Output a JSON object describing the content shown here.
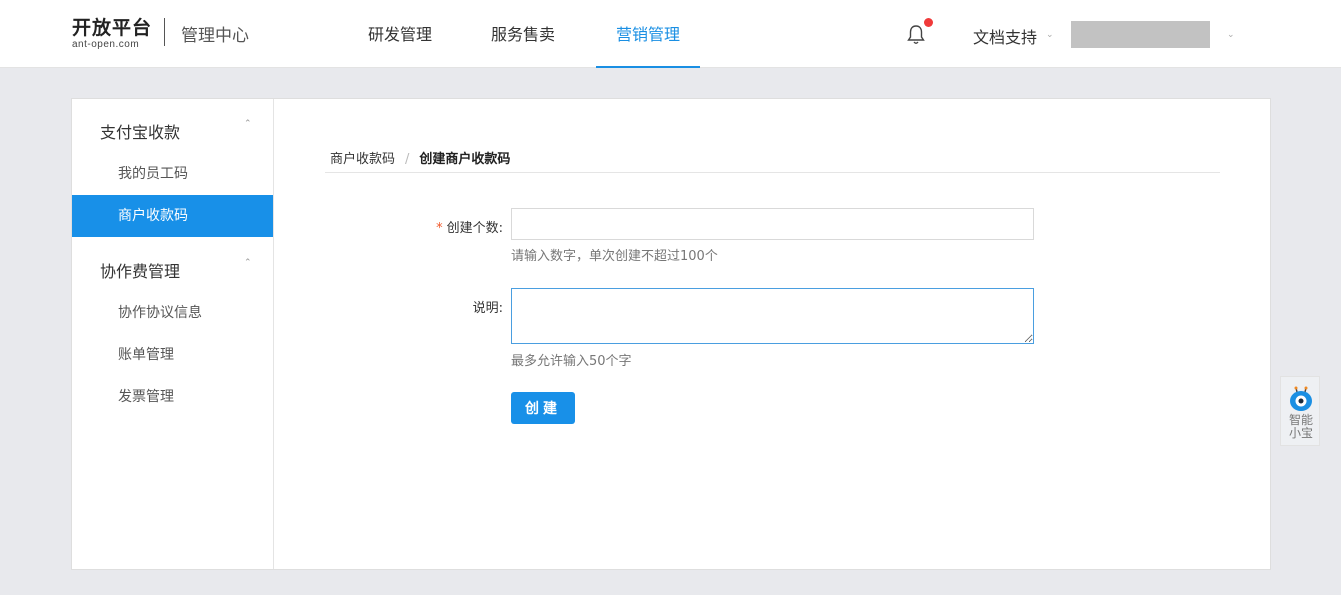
{
  "header": {
    "logo_main": "开放平台",
    "logo_sub": "ant-open.com",
    "logo_center": "管理中心",
    "nav": [
      {
        "label": "研发管理",
        "active": false
      },
      {
        "label": "服务售卖",
        "active": false
      },
      {
        "label": "营销管理",
        "active": true
      }
    ],
    "docs_label": "文档支持",
    "accent_color": "#1a8fe3",
    "notification_color": "#f03a3a"
  },
  "sidebar": {
    "groups": [
      {
        "title": "支付宝收款",
        "items": [
          {
            "label": "我的员工码",
            "active": false
          },
          {
            "label": "商户收款码",
            "active": true
          }
        ]
      },
      {
        "title": "协作费管理",
        "items": [
          {
            "label": "协作协议信息",
            "active": false
          },
          {
            "label": "账单管理",
            "active": false
          },
          {
            "label": "发票管理",
            "active": false
          }
        ]
      }
    ]
  },
  "breadcrumb": {
    "parent": "商户收款码",
    "separator": "/",
    "current": "创建商户收款码"
  },
  "form": {
    "count_label": "创建个数:",
    "count_required_mark": "*",
    "count_value": "",
    "count_hint": "请输入数字，单次创建不超过100个",
    "desc_label": "说明:",
    "desc_value": "",
    "desc_hint": "最多允许输入50个字",
    "submit_label": "创建"
  },
  "assistant": {
    "line1": "智能",
    "line2": "小宝"
  }
}
